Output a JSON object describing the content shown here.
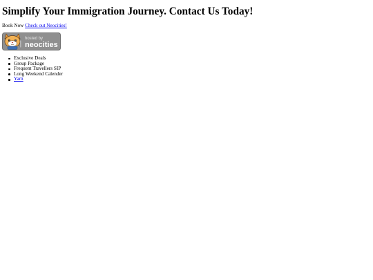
{
  "heading": "Simplify Your Immigration Journey. Contact Us Today!",
  "book_text": "Book Now",
  "neocities_link": "Check out Neocities!",
  "badge": {
    "small_text": "hosted by",
    "big_text": "neocities",
    "icon": "neocities-cat-icon"
  },
  "menu": [
    {
      "label": "Exclusive Deals",
      "link": false
    },
    {
      "label": "Group Package",
      "link": false
    },
    {
      "label": "Frequent Travellers SIP",
      "link": false
    },
    {
      "label": "Long Weekend Calender",
      "link": false
    },
    {
      "label": "Yarn",
      "link": true
    }
  ]
}
